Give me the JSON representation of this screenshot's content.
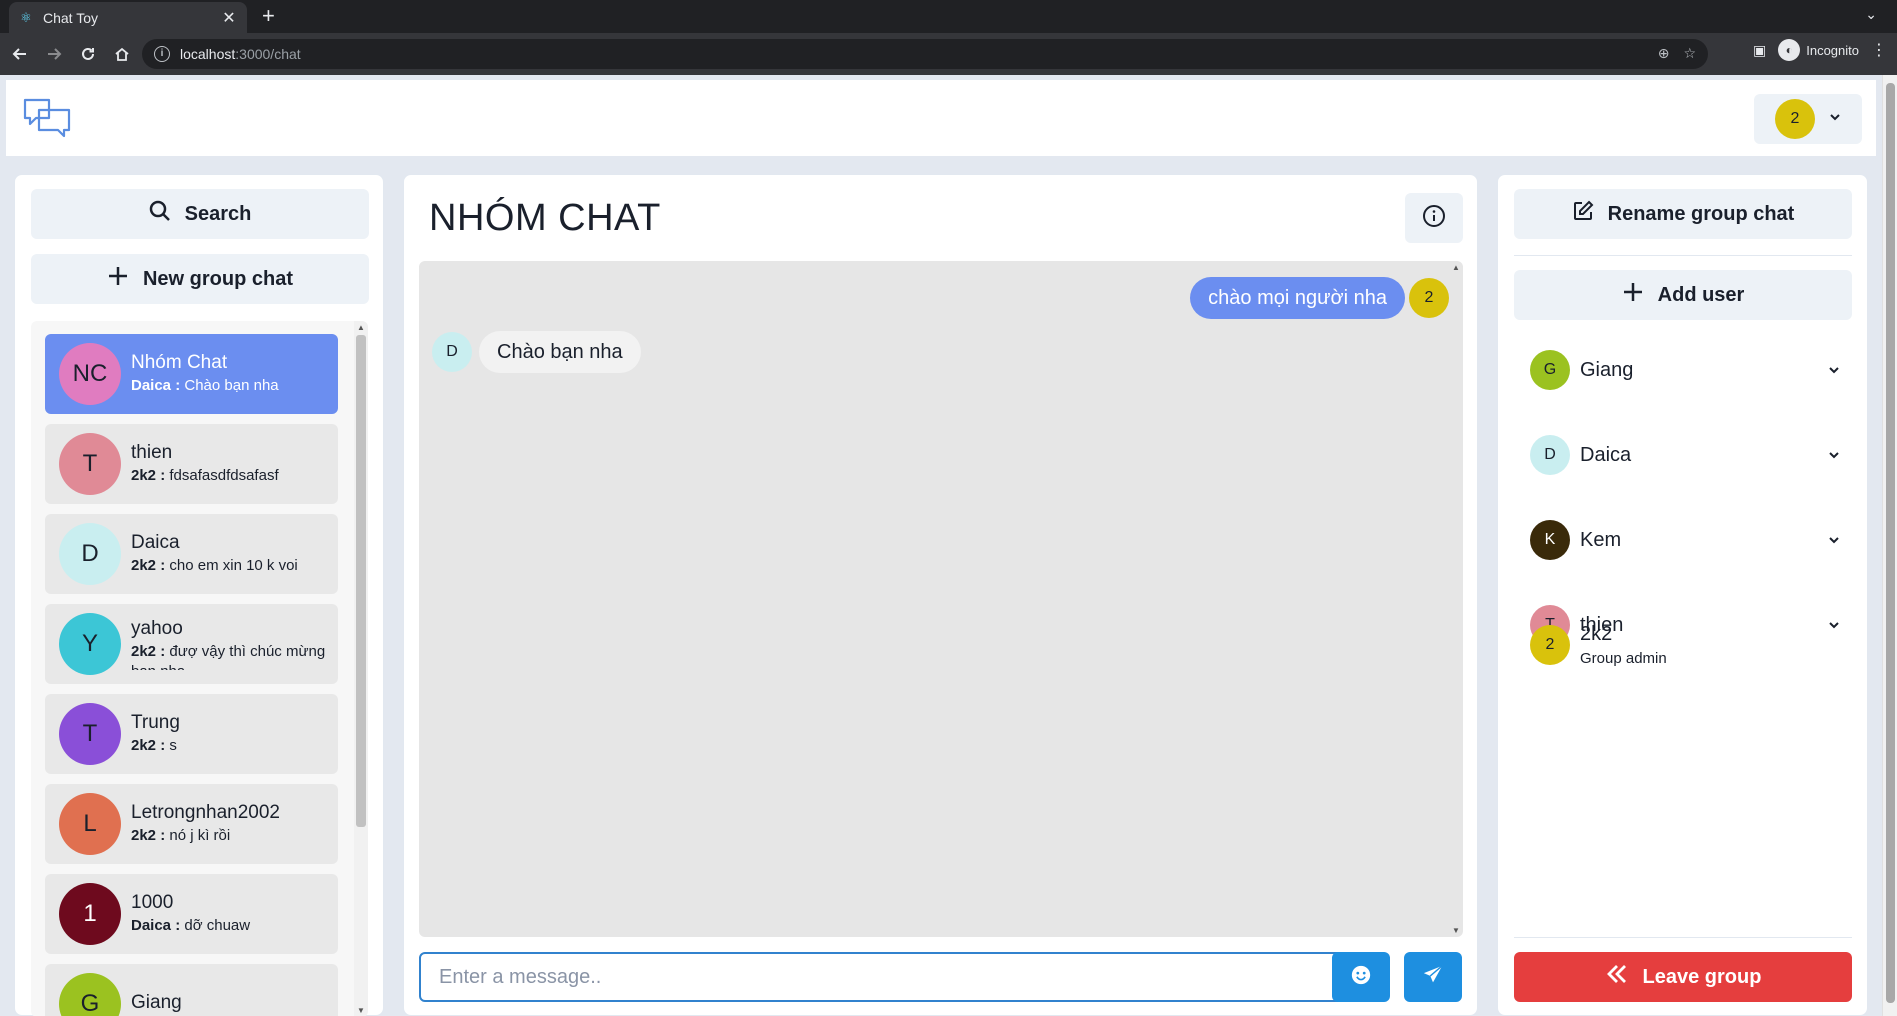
{
  "browser": {
    "tab_title": "Chat Toy",
    "url_host": "localhost",
    "url_path": ":3000/chat",
    "profile_label": "Incognito"
  },
  "header": {
    "user_avatar_letter": "2",
    "user_avatar_color": "#d9c20c"
  },
  "sidebar": {
    "search_label": "Search",
    "new_group_label": "New group chat",
    "chats": [
      {
        "initials": "NC",
        "name": "Nhóm Chat",
        "sender": "Daica :",
        "message": "Chào bạn nha",
        "color": "#e07cc0",
        "active": true
      },
      {
        "initials": "T",
        "name": "thien",
        "sender": "2k2 :",
        "message": "fdsafasdfdsafasf",
        "color": "#e08a96",
        "active": false
      },
      {
        "initials": "D",
        "name": "Daica",
        "sender": "2k2 :",
        "message": "cho em xin 10 k voi",
        "color": "#c9eef0",
        "active": false
      },
      {
        "initials": "Y",
        "name": "yahoo",
        "sender": "2k2 :",
        "message": "đượ vậy thì chúc mừng bạn nha",
        "color": "#3cc6d6",
        "active": false
      },
      {
        "initials": "T",
        "name": "Trung",
        "sender": "2k2 :",
        "message": "s",
        "color": "#8a4fd8",
        "active": false
      },
      {
        "initials": "L",
        "name": "Letrongnhan2002",
        "sender": "2k2 :",
        "message": "nó j kì rồi",
        "color": "#e07050",
        "active": false
      },
      {
        "initials": "1",
        "name": "1000",
        "sender": "Daica :",
        "message": "dỡ chuaw",
        "color": "#6e0a1e",
        "active": false
      },
      {
        "initials": "G",
        "name": "Giang",
        "sender": "",
        "message": "",
        "color": "#9bc220",
        "active": false
      }
    ]
  },
  "chat": {
    "title": "NHÓM CHAT",
    "messages": [
      {
        "direction": "out",
        "text": "chào mọi người nha",
        "avatar": "2"
      },
      {
        "direction": "in",
        "text": "Chào bạn nha",
        "avatar": "D"
      }
    ],
    "input_placeholder": "Enter a message.."
  },
  "group": {
    "rename_label": "Rename group chat",
    "add_user_label": "Add user",
    "members": [
      {
        "initial": "G",
        "name": "Giang",
        "color": "#9bc220",
        "text_color": "#1a202c"
      },
      {
        "initial": "D",
        "name": "Daica",
        "color": "#c9eef0",
        "text_color": "#1a202c"
      },
      {
        "initial": "K",
        "name": "Kem",
        "color": "#3a2a0a",
        "text_color": "#ffffff"
      },
      {
        "initial": "T",
        "name": "thien",
        "color": "#e08a96",
        "text_color": "#1a202c"
      }
    ],
    "admin": {
      "initial": "2",
      "name": "2k2",
      "role": "Group admin",
      "color": "#d9c20c"
    },
    "leave_label": "Leave group"
  }
}
